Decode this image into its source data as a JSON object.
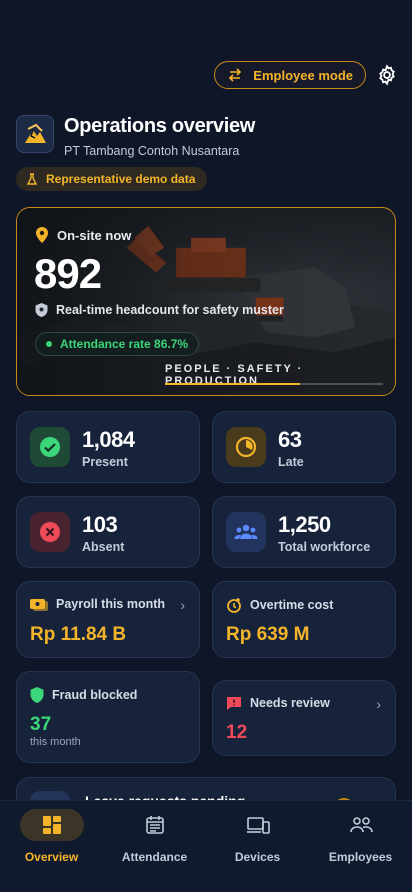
{
  "header": {
    "mode_button": "Employee mode",
    "title": "Operations overview",
    "company": "PT Tambang Contoh Nusantara",
    "demo_badge": "Representative demo data"
  },
  "hero": {
    "onsite_label": "On-site now",
    "onsite_count": "892",
    "muster_text": "Real-time headcount for safety muster",
    "attendance_text": "Attendance rate 86.7%",
    "tagline": "PEOPLE · SAFETY · PRODUCTION",
    "progress": 0.62
  },
  "stats": [
    {
      "value": "1,084",
      "label": "Present",
      "color": "#3bd57a"
    },
    {
      "value": "63",
      "label": "Late",
      "color": "#f4b42a"
    },
    {
      "value": "103",
      "label": "Absent",
      "color": "#ef4a5a"
    },
    {
      "value": "1,250",
      "label": "Total workforce",
      "color": "#5b8cff"
    }
  ],
  "finance": {
    "payroll_label": "Payroll this month",
    "payroll_value": "Rp 11.84 B",
    "overtime_label": "Overtime cost",
    "overtime_value": "Rp 639 M",
    "fraud_label": "Fraud blocked",
    "fraud_value": "37",
    "fraud_sub": "this month",
    "review_label": "Needs review",
    "review_value": "12"
  },
  "partial_card": {
    "title": "Leave requests pending"
  },
  "nav": [
    {
      "label": "Overview",
      "icon": "dashboard-icon",
      "active": true
    },
    {
      "label": "Attendance",
      "icon": "calendar-icon",
      "active": false
    },
    {
      "label": "Devices",
      "icon": "devices-icon",
      "active": false
    },
    {
      "label": "Employees",
      "icon": "people-icon",
      "active": false
    }
  ],
  "colors": {
    "accent": "#f4b42a",
    "background": "#0e1628",
    "card": "#17233b",
    "success": "#3bd57a",
    "danger": "#ef4a5a"
  }
}
